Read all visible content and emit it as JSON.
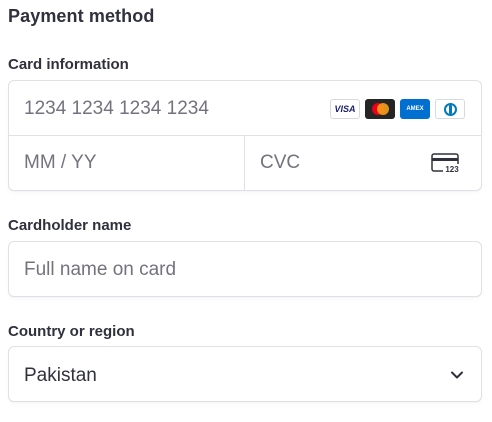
{
  "payment": {
    "title": "Payment method",
    "card_info_label": "Card information",
    "card_number_placeholder": "1234 1234 1234 1234",
    "expiry_placeholder": "MM / YY",
    "cvc_placeholder": "CVC",
    "cvc_icon_text": "123",
    "brands": [
      {
        "name": "visa-icon",
        "text": "VISA"
      },
      {
        "name": "mastercard-icon",
        "text": ""
      },
      {
        "name": "amex-icon",
        "text": "AMEX"
      },
      {
        "name": "diners-club-icon",
        "text": ""
      }
    ],
    "cardholder_label": "Cardholder name",
    "cardholder_placeholder": "Full name on card",
    "country_label": "Country or region",
    "country_value": "Pakistan"
  },
  "colors": {
    "text": "#30313d",
    "placeholder": "#73737d",
    "border": "#e0e0e6",
    "visa_blue": "#1a1f71",
    "amex_blue": "#016fd0",
    "mc_red": "#eb001b",
    "mc_orange": "#f79e1b"
  }
}
